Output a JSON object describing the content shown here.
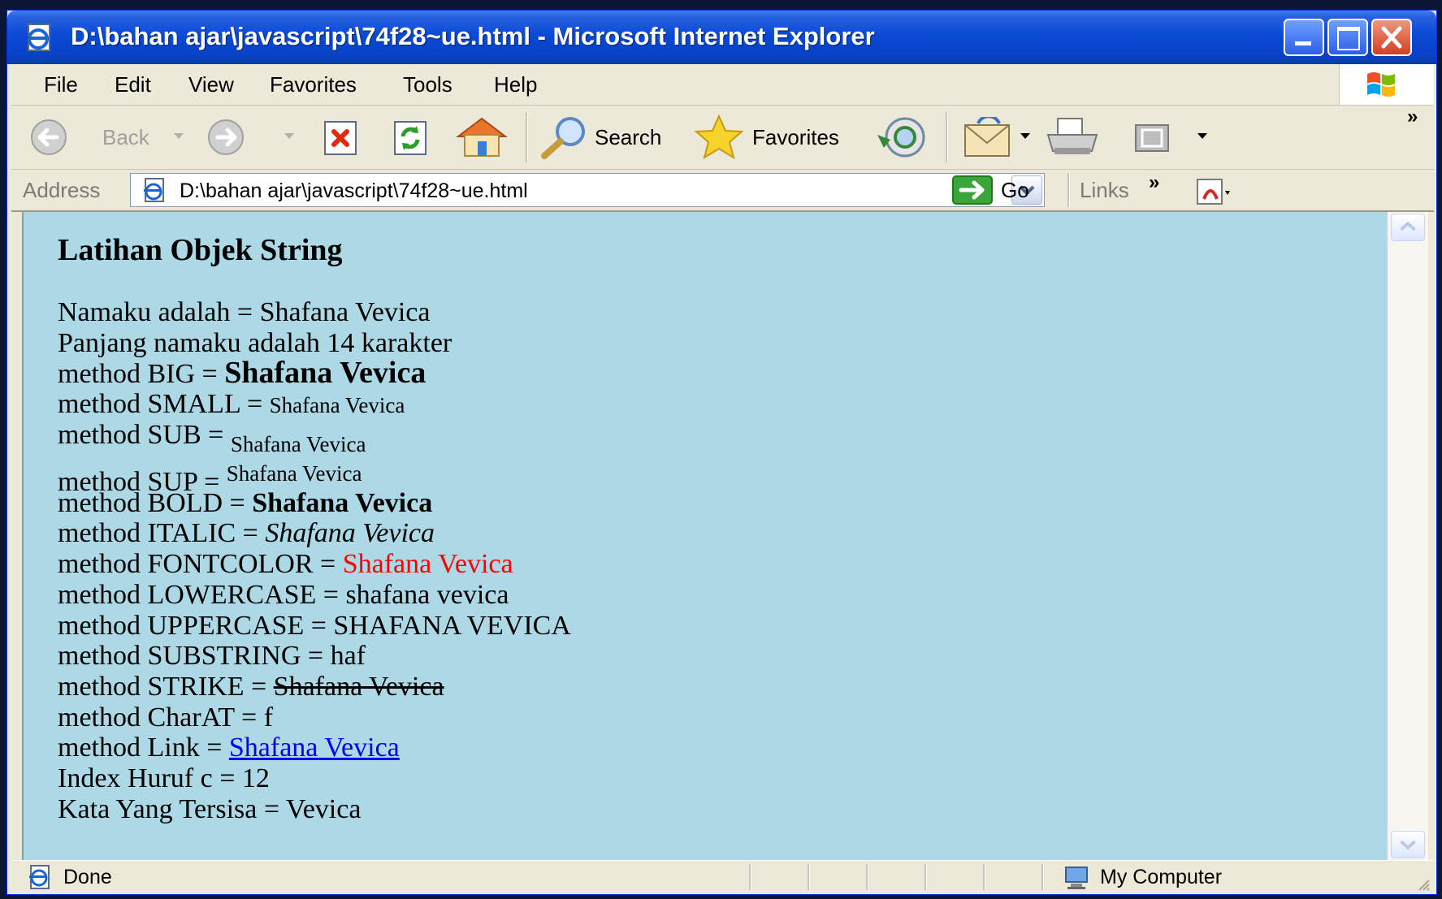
{
  "window": {
    "title": "D:\\bahan ajar\\javascript\\74f28~ue.html - Microsoft Internet Explorer"
  },
  "menu": [
    "File",
    "Edit",
    "View",
    "Favorites",
    "Tools",
    "Help"
  ],
  "toolbar": {
    "back_label": "Back",
    "search_label": "Search",
    "favorites_label": "Favorites"
  },
  "address": {
    "label": "Address",
    "value": "D:\\bahan ajar\\javascript\\74f28~ue.html",
    "go_label": "Go",
    "links_label": "Links"
  },
  "page": {
    "heading": "Latihan Objek String",
    "lines": [
      {
        "label": "Namaku adalah = ",
        "value": "Shafana Vevica"
      },
      {
        "label": "Panjang namaku adalah 14 karakter",
        "value": ""
      },
      {
        "label": "method BIG = ",
        "value": "Shafana Vevica"
      },
      {
        "label": "method SMALL = ",
        "value": "Shafana Vevica"
      },
      {
        "label": "method SUB = ",
        "value": "Shafana Vevica"
      },
      {
        "label": "method SUP = ",
        "value": "Shafana Vevica"
      },
      {
        "label": "method BOLD = ",
        "value": "Shafana Vevica"
      },
      {
        "label": "method ITALIC = ",
        "value": "Shafana Vevica"
      },
      {
        "label": "method FONTCOLOR = ",
        "value": "Shafana Vevica"
      },
      {
        "label": "method LOWERCASE = ",
        "value": "shafana vevica"
      },
      {
        "label": "method UPPERCASE = ",
        "value": "SHAFANA VEVICA"
      },
      {
        "label": "method SUBSTRING = ",
        "value": "haf"
      },
      {
        "label": "method STRIKE = ",
        "value": "Shafana Vevica"
      },
      {
        "label": "method CharAT = ",
        "value": "f"
      },
      {
        "label": "method Link = ",
        "value": "Shafana Vevica"
      },
      {
        "label": "Index Huruf c = ",
        "value": "12"
      },
      {
        "label": "Kata Yang Tersisa = ",
        "value": "Vevica"
      }
    ]
  },
  "status": {
    "text": "Done",
    "zone": "My Computer"
  },
  "colors": {
    "page_background": "#add8e6",
    "fontcolor_red": "#ff0000",
    "link_blue": "#0000ee"
  }
}
